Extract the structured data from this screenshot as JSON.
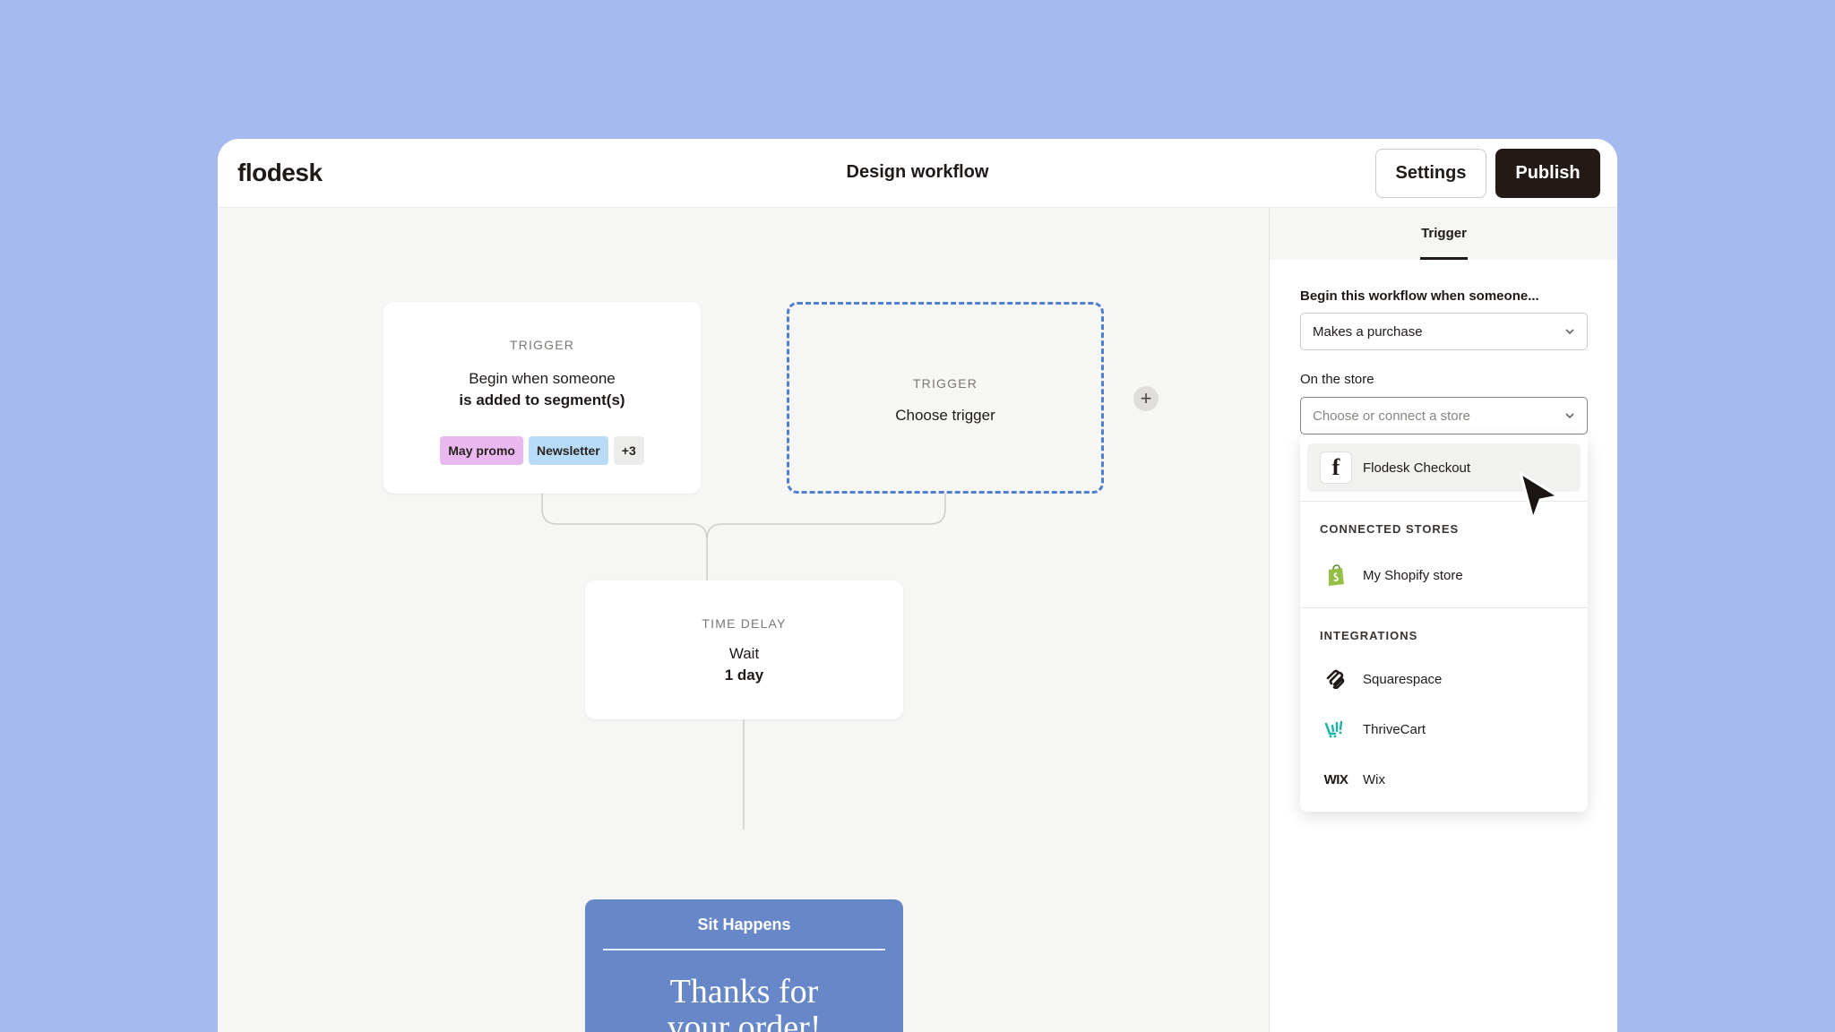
{
  "app": {
    "logo": "flodesk",
    "title": "Design workflow"
  },
  "header": {
    "settings_label": "Settings",
    "publish_label": "Publish"
  },
  "canvas": {
    "trigger1": {
      "label": "TRIGGER",
      "line1": "Begin when someone",
      "line2": "is added to segment(s)",
      "tags": [
        "May promo",
        "Newsletter",
        "+3"
      ]
    },
    "trigger2": {
      "label": "TRIGGER",
      "text": "Choose trigger"
    },
    "add_icon": "plus-icon",
    "delay": {
      "label": "TIME DELAY",
      "line1": "Wait",
      "line2": "1 day"
    },
    "email": {
      "brand": "Sit Happens",
      "headline1": "Thanks for",
      "headline2": "your order!"
    }
  },
  "panel": {
    "tab": "Trigger",
    "begin_label": "Begin this workflow when someone...",
    "begin_value": "Makes a purchase",
    "store_label": "On the store",
    "store_placeholder": "Choose or connect a store",
    "dropdown": {
      "featured": {
        "label": "Flodesk Checkout",
        "icon": "flodesk-f-icon"
      },
      "connected_heading": "CONNECTED STORES",
      "connected": [
        {
          "label": "My Shopify store",
          "icon": "shopify-icon"
        }
      ],
      "integrations_heading": "INTEGRATIONS",
      "integrations": [
        {
          "label": "Squarespace",
          "icon": "squarespace-icon"
        },
        {
          "label": "ThriveCart",
          "icon": "thrivecart-icon"
        },
        {
          "label": "Wix",
          "icon": "wix-icon",
          "mark": "WIX"
        }
      ]
    }
  },
  "colors": {
    "background": "#a5baee",
    "publish": "#241b18",
    "dashed_border": "#4f7fd1",
    "tag_pink": "#e9b8ef",
    "tag_blue": "#b8dcf7",
    "email_bg": "#6887c9",
    "shopify": "#95bf47",
    "thrivecart": "#17b3a5"
  }
}
